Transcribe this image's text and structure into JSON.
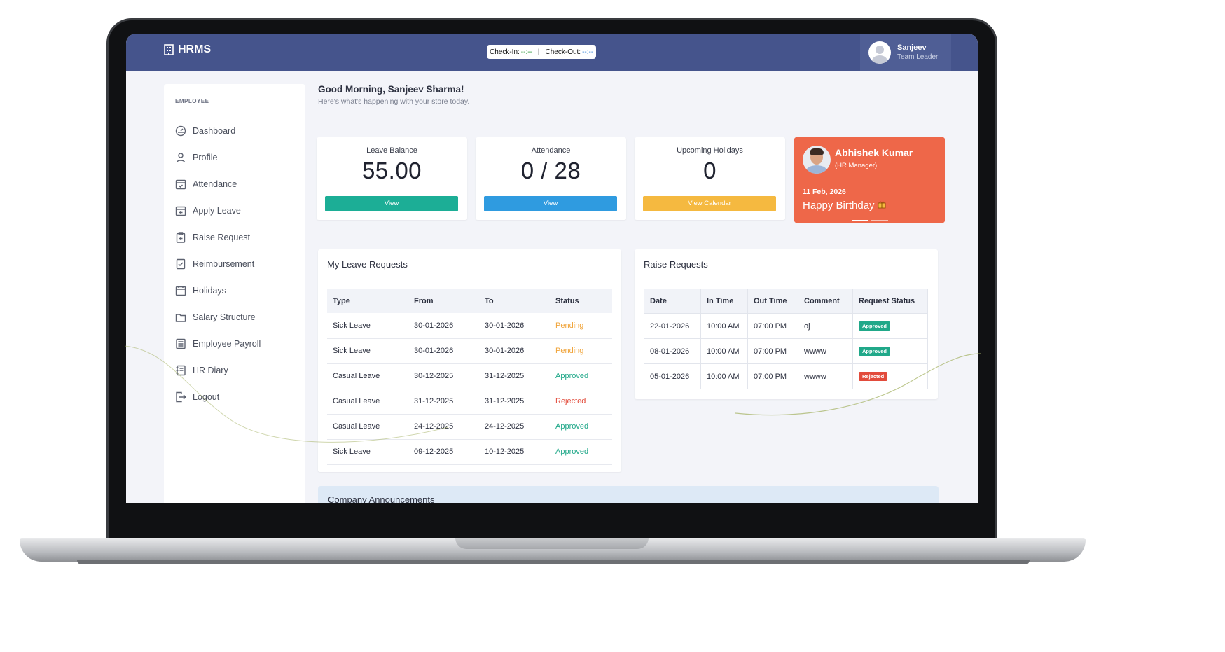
{
  "app": {
    "brand": "HRMS"
  },
  "checkin": {
    "in_label": "Check-In:",
    "in_value": "--:--",
    "separator": "|",
    "out_label": "Check-Out:",
    "out_value": "--:--"
  },
  "user": {
    "name": "Sanjeev",
    "role": "Team Leader"
  },
  "sidebar": {
    "heading": "EMPLOYEE",
    "items": [
      {
        "label": "Dashboard",
        "icon": "dashboard-icon"
      },
      {
        "label": "Profile",
        "icon": "user-icon"
      },
      {
        "label": "Attendance",
        "icon": "calendar-check-icon"
      },
      {
        "label": "Apply Leave",
        "icon": "calendar-plus-icon"
      },
      {
        "label": "Raise Request",
        "icon": "clipboard-plus-icon"
      },
      {
        "label": "Reimbursement",
        "icon": "receipt-check-icon"
      },
      {
        "label": "Holidays",
        "icon": "calendar-icon"
      },
      {
        "label": "Salary Structure",
        "icon": "folder-icon"
      },
      {
        "label": "Employee Payroll",
        "icon": "ledger-icon"
      },
      {
        "label": "HR Diary",
        "icon": "notebook-icon"
      },
      {
        "label": "Logout",
        "icon": "logout-icon"
      }
    ]
  },
  "greeting": {
    "title": "Good Morning, Sanjeev Sharma!",
    "subtitle": "Here's what's happening with your store today."
  },
  "stats": [
    {
      "label": "Leave Balance",
      "value": "55.00",
      "button": "View",
      "color": "#1cae96"
    },
    {
      "label": "Attendance",
      "value": "0 / 28",
      "button": "View",
      "color": "#2f9be0"
    },
    {
      "label": "Upcoming Holidays",
      "value": "0",
      "button": "View Calendar",
      "color": "#f5b940"
    }
  ],
  "birthday": {
    "name": "Abhishek Kumar",
    "role": "(HR Manager)",
    "date": "11 Feb, 2026",
    "message": "Happy Birthday",
    "color": "#ee6749"
  },
  "leave_requests": {
    "title": "My Leave Requests",
    "columns": [
      "Type",
      "From",
      "To",
      "Status"
    ],
    "rows": [
      {
        "type": "Sick Leave",
        "from": "30-01-2026",
        "to": "30-01-2026",
        "status": "Pending"
      },
      {
        "type": "Sick Leave",
        "from": "30-01-2026",
        "to": "30-01-2026",
        "status": "Pending"
      },
      {
        "type": "Casual Leave",
        "from": "30-12-2025",
        "to": "31-12-2025",
        "status": "Approved"
      },
      {
        "type": "Casual Leave",
        "from": "31-12-2025",
        "to": "31-12-2025",
        "status": "Rejected"
      },
      {
        "type": "Casual Leave",
        "from": "24-12-2025",
        "to": "24-12-2025",
        "status": "Approved"
      },
      {
        "type": "Sick Leave",
        "from": "09-12-2025",
        "to": "10-12-2025",
        "status": "Approved"
      }
    ]
  },
  "raise_requests": {
    "title": "Raise Requests",
    "columns": [
      "Date",
      "In Time",
      "Out Time",
      "Comment",
      "Request Status"
    ],
    "rows": [
      {
        "date": "22-01-2026",
        "in": "10:00 AM",
        "out": "07:00 PM",
        "comment": "oj",
        "status": "Approved"
      },
      {
        "date": "08-01-2026",
        "in": "10:00 AM",
        "out": "07:00 PM",
        "comment": "wwww",
        "status": "Approved"
      },
      {
        "date": "05-01-2026",
        "in": "10:00 AM",
        "out": "07:00 PM",
        "comment": "wwww",
        "status": "Rejected"
      }
    ]
  },
  "announcements": {
    "title": "Company Announcements"
  },
  "colors": {
    "header": "#45548c",
    "pending": "#f0a43a",
    "approved": "#20a889",
    "rejected": "#e24b3b"
  }
}
